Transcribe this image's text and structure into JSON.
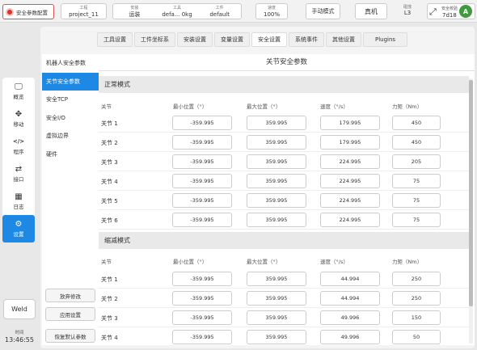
{
  "topbar": {
    "safety_config_label": "安全参数配置",
    "project_label": "工程",
    "project_value": "project_11",
    "tool_end_label": "安装",
    "tool_end_value": "运装",
    "tool_label": "工具",
    "tool_value": "defa...  0kg",
    "workpiece_label": "工件",
    "workpiece_value": "default",
    "speed_label": "速度",
    "speed_value": "100%",
    "manual_mode_label": "手动模式",
    "real_machine_label": "真机",
    "collision_label": "碰撞",
    "collision_value": "L3",
    "safety_check_label": "安全校验",
    "safety_check_value": "7d18",
    "avatar_letter": "A"
  },
  "nav": {
    "items": [
      {
        "label": "概览",
        "icon": "monitor-icon"
      },
      {
        "label": "移动",
        "icon": "move-icon"
      },
      {
        "label": "程序",
        "icon": "code-icon"
      },
      {
        "label": "接口",
        "icon": "swap-icon"
      },
      {
        "label": "日志",
        "icon": "calendar-icon"
      },
      {
        "label": "设置",
        "icon": "gear-icon"
      }
    ],
    "active": "设置",
    "weld_label": "Weld",
    "time_label": "时间",
    "time_value": "13:46:55"
  },
  "tabs": [
    "工具设置",
    "工件坐标系",
    "安装设置",
    "变量设置",
    "安全设置",
    "系统事件",
    "其他设置",
    "Plugins"
  ],
  "active_tab": "安全设置",
  "submenu": {
    "items": [
      "机器人安全参数",
      "关节安全参数",
      "安全TCP",
      "安全I/O",
      "虚拟边界",
      "硬件"
    ],
    "active": "关节安全参数",
    "discard_label": "放弃修改",
    "apply_label": "应用设置",
    "restore_label": "恢复默认参数"
  },
  "content": {
    "title": "关节安全参数",
    "headers": {
      "joint": "关节",
      "min": "最小位置（°）",
      "max": "最大位置（°）",
      "speed": "速度（°/s）",
      "torque": "力矩（Nm）"
    },
    "normal": {
      "title": "正常模式",
      "rows": [
        {
          "joint": "关节 1",
          "min": "-359.995",
          "max": "359.995",
          "speed": "179.995",
          "torque": "450"
        },
        {
          "joint": "关节 2",
          "min": "-359.995",
          "max": "359.995",
          "speed": "179.995",
          "torque": "450"
        },
        {
          "joint": "关节 3",
          "min": "-359.995",
          "max": "359.995",
          "speed": "224.995",
          "torque": "205"
        },
        {
          "joint": "关节 4",
          "min": "-359.995",
          "max": "359.995",
          "speed": "224.995",
          "torque": "75"
        },
        {
          "joint": "关节 5",
          "min": "-359.995",
          "max": "359.995",
          "speed": "224.995",
          "torque": "75"
        },
        {
          "joint": "关节 6",
          "min": "-359.995",
          "max": "359.995",
          "speed": "224.995",
          "torque": "75"
        }
      ]
    },
    "reduced": {
      "title": "缩减模式",
      "rows": [
        {
          "joint": "关节 1",
          "min": "-359.995",
          "max": "359.995",
          "speed": "44.994",
          "torque": "250"
        },
        {
          "joint": "关节 2",
          "min": "-359.995",
          "max": "359.995",
          "speed": "44.994",
          "torque": "250"
        },
        {
          "joint": "关节 3",
          "min": "-359.995",
          "max": "359.995",
          "speed": "49.996",
          "torque": "150"
        },
        {
          "joint": "关节 4",
          "min": "-359.995",
          "max": "359.995",
          "speed": "49.996",
          "torque": "50"
        }
      ]
    }
  }
}
